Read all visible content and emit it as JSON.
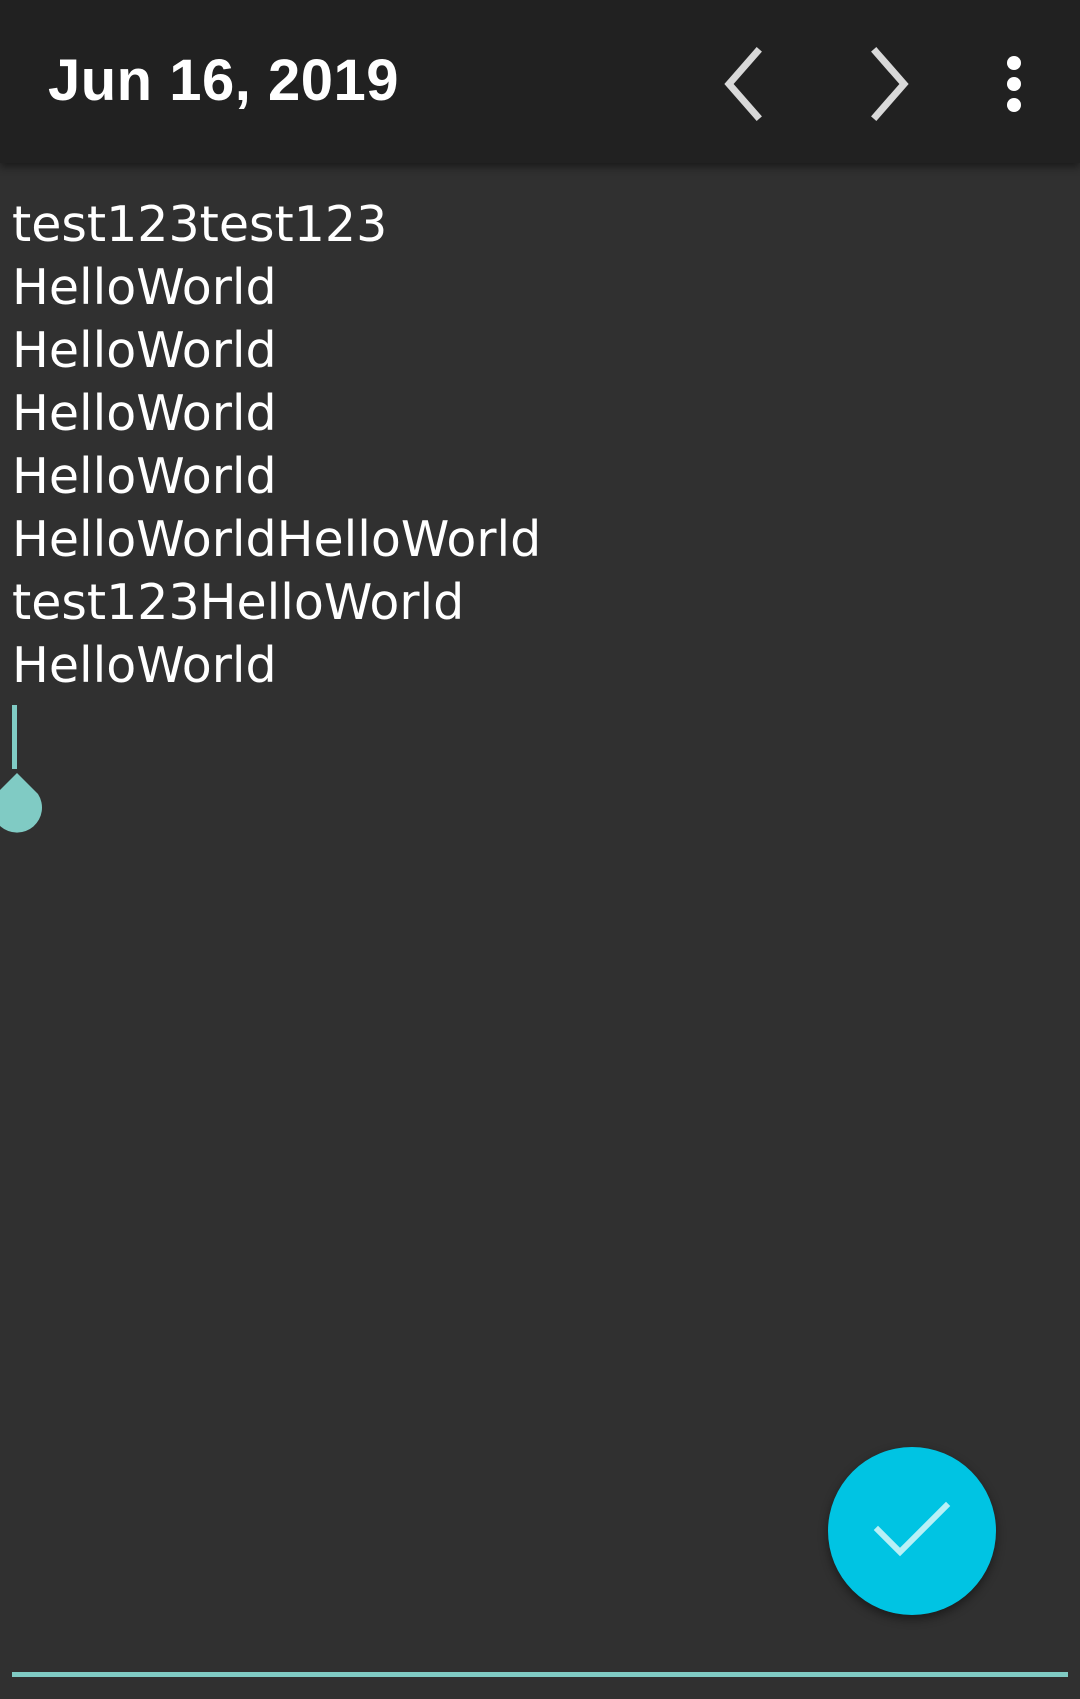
{
  "app_bar": {
    "title": "Jun 16, 2019",
    "icons": {
      "prev": "chevron-left-icon",
      "next": "chevron-right-icon",
      "more": "more-vertical-icon"
    },
    "background": "#212121"
  },
  "editor": {
    "text": "test123test123\nHelloWorld\nHelloWorld\nHelloWorld\nHelloWorld\nHelloWorldHelloWorld\ntest123HelloWorld\nHelloWorld\n",
    "accent": "#80cbc4",
    "background": "#303030"
  },
  "fab": {
    "icon": "check-icon",
    "color": "#00c4e3"
  }
}
